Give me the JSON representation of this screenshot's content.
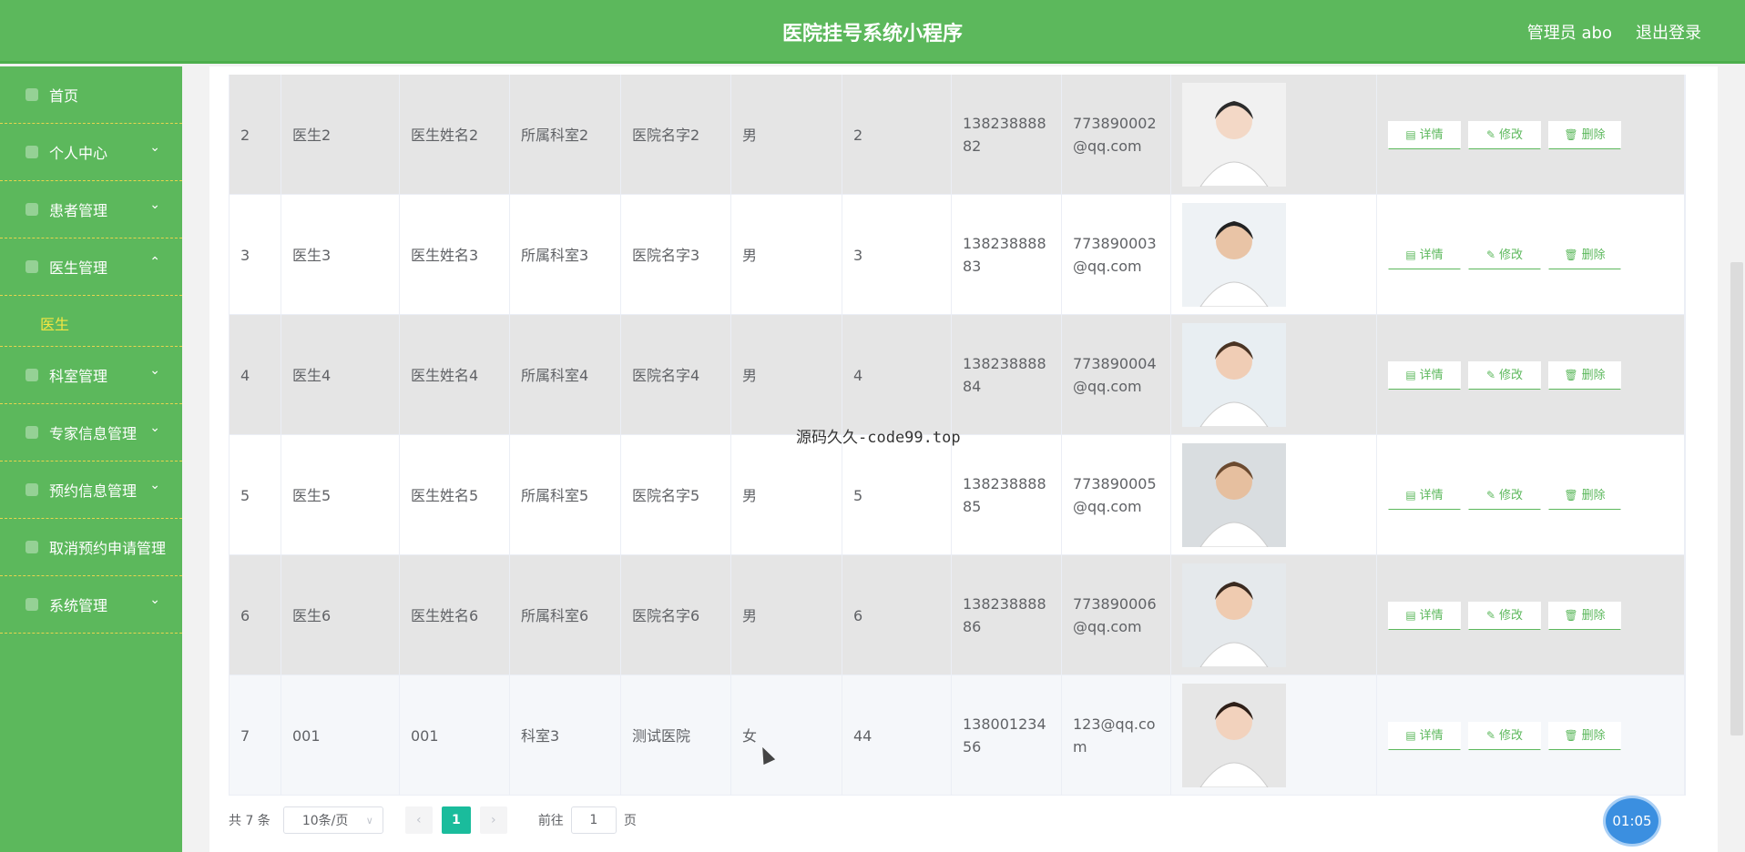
{
  "header": {
    "title": "医院挂号系统小程序",
    "user": "管理员 abo",
    "logout": "退出登录"
  },
  "sidebar": {
    "items": [
      {
        "label": "首页",
        "arrow": ""
      },
      {
        "label": "个人中心",
        "arrow": "⌄"
      },
      {
        "label": "患者管理",
        "arrow": "⌄"
      },
      {
        "label": "医生管理",
        "arrow": "⌃"
      },
      {
        "label": "科室管理",
        "arrow": "⌄"
      },
      {
        "label": "专家信息管理",
        "arrow": "⌄"
      },
      {
        "label": "预约信息管理",
        "arrow": "⌄"
      },
      {
        "label": "取消预约申请管理",
        "arrow": ""
      },
      {
        "label": "系统管理",
        "arrow": "⌄"
      }
    ],
    "active_sub": "医生"
  },
  "table": {
    "rows": [
      {
        "idx": "2",
        "account": "医生2",
        "name": "医生姓名2",
        "dept": "所属科室2",
        "hospital": "医院名字2",
        "gender": "男",
        "age": "2",
        "phone": "13823888882",
        "email": "773890002@qq.com",
        "avatar": "doctor-female-1"
      },
      {
        "idx": "3",
        "account": "医生3",
        "name": "医生姓名3",
        "dept": "所属科室3",
        "hospital": "医院名字3",
        "gender": "男",
        "age": "3",
        "phone": "13823888883",
        "email": "773890003@qq.com",
        "avatar": "doctor-male-1"
      },
      {
        "idx": "4",
        "account": "医生4",
        "name": "医生姓名4",
        "dept": "所属科室4",
        "hospital": "医院名字4",
        "gender": "男",
        "age": "4",
        "phone": "13823888884",
        "email": "773890004@qq.com",
        "avatar": "doctor-female-2"
      },
      {
        "idx": "5",
        "account": "医生5",
        "name": "医生姓名5",
        "dept": "所属科室5",
        "hospital": "医院名字5",
        "gender": "男",
        "age": "5",
        "phone": "13823888885",
        "email": "773890005@qq.com",
        "avatar": "doctor-male-2"
      },
      {
        "idx": "6",
        "account": "医生6",
        "name": "医生姓名6",
        "dept": "所属科室6",
        "hospital": "医院名字6",
        "gender": "男",
        "age": "6",
        "phone": "13823888886",
        "email": "773890006@qq.com",
        "avatar": "doctor-female-3"
      },
      {
        "idx": "7",
        "account": "001",
        "name": "001",
        "dept": "科室3",
        "hospital": "测试医院",
        "gender": "女",
        "age": "44",
        "phone": "13800123456",
        "email": "123@qq.com",
        "avatar": "doctor-female-4"
      }
    ],
    "actions": {
      "detail": "详情",
      "edit": "修改",
      "delete": "删除"
    }
  },
  "pagination": {
    "total": "共 7 条",
    "page_size": "10条/页",
    "current_page": "1",
    "goto_prefix": "前往",
    "goto_value": "1",
    "goto_suffix": "页"
  },
  "overlay": {
    "timer": "01:05",
    "center_text": "源码久久-code99.top"
  },
  "colors": {
    "primary": "#5cb85c",
    "active_page": "#1abc9c",
    "submenu_active": "#f5e642"
  }
}
